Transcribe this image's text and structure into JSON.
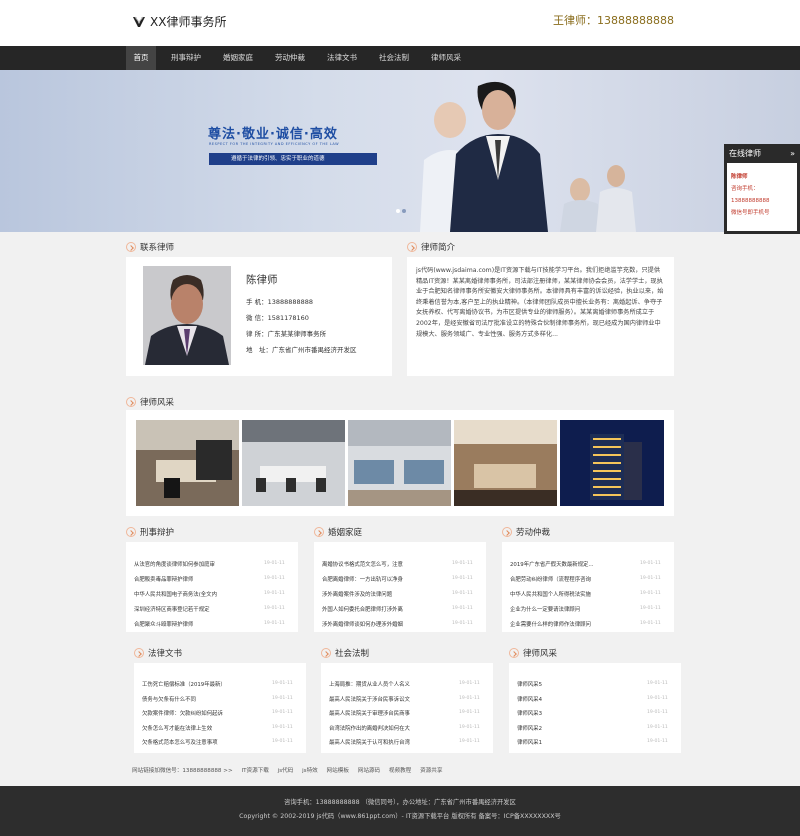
{
  "header": {
    "logo_text": "XX律师事务所",
    "hotline": "王律师：13888888888"
  },
  "nav": [
    "首页",
    "刑事辩护",
    "婚姻家庭",
    "劳动仲裁",
    "法律文书",
    "社会法制",
    "律师风采"
  ],
  "banner": {
    "slogan": "尊法·敬业·诚信·高效",
    "slogan_en": "RESPECT FOR THE INTEGRITY AND EFFICIENCY OF THE LAW",
    "slogan_sub": "遵循于法律的引领、忠实于职业的道德"
  },
  "float_box": {
    "title": "在线律师",
    "arrow": "»",
    "lines": [
      "陈律师",
      "咨询手机：",
      "13888888888",
      "微信号即手机号"
    ]
  },
  "contact": {
    "title": "联系律师",
    "name": "陈律师",
    "rows": [
      "手 机：13888888888",
      "微 信：1581178160",
      "律 所：广东某某律师事务所",
      "地　址：广东省广州市番禺经济开发区"
    ]
  },
  "intro": {
    "title": "律师简介",
    "text": "js代码(www.jsdaima.com)是IT资源下载与IT技能学习平台。我们拒绝滥竽充数，只提供精品IT资源！某某离婚律师事务所，司法部注册律师，某某律师协会会员，法学学士，现执业于合肥知名律师事务所安徽安大律师事务所。本律师具有丰富的诉讼经验，执业以来，始终秉着信誉为本,客户至上的执业精神。（本律师团队成员中擅长业务有：离婚起诉、争夺子女抚养权、代写离婚协议书，为市区提供专业的律师服务）。某某离婚律师事务所成立于2002年，是经安徽省司法厅批准设立的特殊合伙制律师事务所，现已经成为国内律师业中规模大、服务领域广、专业性强、服务方式多样化..."
  },
  "gallery_title": "律师风采",
  "sections": [
    {
      "title": "刑事辩护",
      "items": [
        {
          "t": "从法官的角度谈律师如何参加庭审",
          "d": "19-01-11"
        },
        {
          "t": "合肥販卖毒品罪辩护律师",
          "d": "19-01-11"
        },
        {
          "t": "中华人民共和国电子商务法(全文内",
          "d": "19-01-11"
        },
        {
          "t": "深圳经济特区商事登记若干规定",
          "d": "19-01-11"
        },
        {
          "t": "合肥聚众斗殴罪辩护律师",
          "d": "19-01-11"
        }
      ]
    },
    {
      "title": "婚姻家庭",
      "items": [
        {
          "t": "离婚协议书格式范文怎么写，注意",
          "d": "19-01-11"
        },
        {
          "t": "合肥离婚律师：一方出轨可以净身",
          "d": "19-01-11"
        },
        {
          "t": "涉外离婚案件涉及的法律问题",
          "d": "19-01-11"
        },
        {
          "t": "外国人如何委托合肥律师打涉外离",
          "d": "19-01-11"
        },
        {
          "t": "涉外离婚律师谈如何办理涉外婚姻",
          "d": "19-01-11"
        }
      ]
    },
    {
      "title": "劳动仲裁",
      "items": [
        {
          "t": "2019年广东省产假天数最新规定...",
          "d": "19-01-11"
        },
        {
          "t": "合肥劳动纠纷律师（流程程序咨询",
          "d": "19-01-11"
        },
        {
          "t": "中华人民共和国个人所得税法实施",
          "d": "19-01-11"
        },
        {
          "t": "企业为什么一定要请法律顾问",
          "d": "19-01-11"
        },
        {
          "t": "企业需要什么样的律师作法律顾问",
          "d": "19-01-11"
        }
      ]
    },
    {
      "title": "法律文书",
      "items": [
        {
          "t": "工伤死亡赔偿标准（2019年最新）",
          "d": "19-01-11"
        },
        {
          "t": "债务与欠条有什么不同",
          "d": "19-01-11"
        },
        {
          "t": "欠款案件律师：欠款纠纷如何起诉",
          "d": "19-01-11"
        },
        {
          "t": "欠条怎么写才能在法律上生效",
          "d": "19-01-11"
        },
        {
          "t": "欠条格式范本怎么写及注意事项",
          "d": "19-01-11"
        }
      ]
    },
    {
      "title": "社会法制",
      "items": [
        {
          "t": "上海局推：期货从业人员个人名义",
          "d": "19-01-11"
        },
        {
          "t": "最高人民法院关于涉台民事诉讼文",
          "d": "19-01-11"
        },
        {
          "t": "最高人民法院关于审理涉台民商事",
          "d": "19-01-11"
        },
        {
          "t": "台湾法院作出的离婚判决如何在大",
          "d": "19-01-11"
        },
        {
          "t": "最高人民法院关于认可和执行台湾",
          "d": "19-01-11"
        }
      ]
    },
    {
      "title": "律师风采",
      "items": [
        {
          "t": "律师风采5",
          "d": "19-01-11"
        },
        {
          "t": "律师风采4",
          "d": "19-01-11"
        },
        {
          "t": "律师风采3",
          "d": "19-01-11"
        },
        {
          "t": "律师风采2",
          "d": "19-01-11"
        },
        {
          "t": "律师风采1",
          "d": "19-01-11"
        }
      ]
    }
  ],
  "links": [
    "网站链接加微信号：13888888888 >>",
    "IT资源下载",
    "js代码",
    "js特效",
    "网站模板",
    "网站源码",
    "视频教程",
    "资源共享"
  ],
  "footer": {
    "line1": "咨询手机：13888888888 （微信同号），办公地址：广东省广州市番禺经济开发区",
    "line2": "Copyright © 2002-2019 js代码（www.861ppt.com）- IT资源下载平台 版权所有 备案号：ICP备XXXXXXXX号"
  }
}
